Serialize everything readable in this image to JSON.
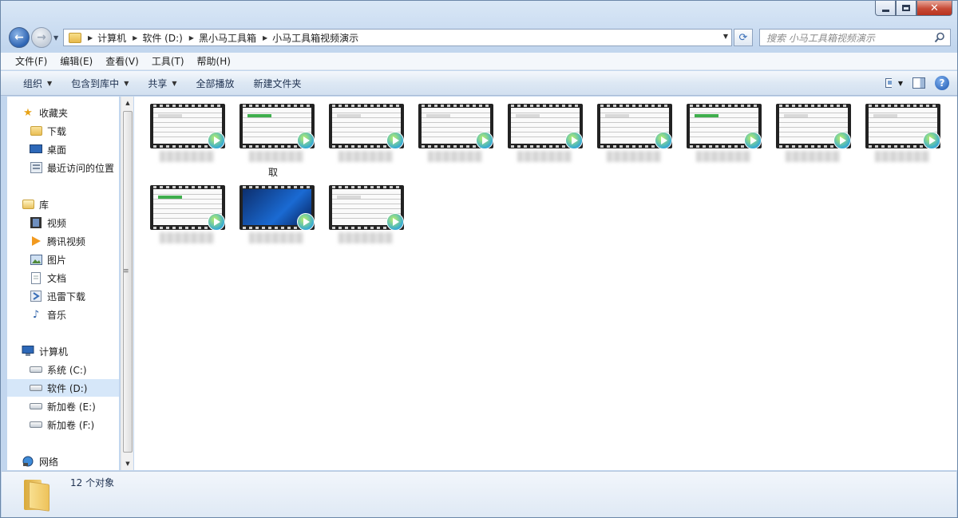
{
  "window": {
    "caption_buttons": [
      "minimize",
      "maximize",
      "close"
    ]
  },
  "address": {
    "breadcrumbs": [
      "计算机",
      "软件 (D:)",
      "黑小马工具箱",
      "小马工具箱视频演示"
    ]
  },
  "search": {
    "placeholder": "搜索 小马工具箱视频演示"
  },
  "menu": {
    "items": [
      "文件(F)",
      "编辑(E)",
      "查看(V)",
      "工具(T)",
      "帮助(H)"
    ]
  },
  "toolbar": {
    "organize": "组织",
    "include_in_library": "包含到库中",
    "share": "共享",
    "play_all": "全部播放",
    "new_folder": "新建文件夹"
  },
  "nav": {
    "favorites": "收藏夹",
    "fav_items": [
      "下载",
      "桌面",
      "最近访问的位置"
    ],
    "libraries": "库",
    "lib_items": [
      "视频",
      "腾讯视频",
      "图片",
      "文档",
      "迅雷下载",
      "音乐"
    ],
    "computer": "计算机",
    "drives": [
      "系统 (C:)",
      "软件 (D:)",
      "新加卷 (E:)",
      "新加卷 (F:)"
    ],
    "network": "网络"
  },
  "files": {
    "visible_label_fragment": "取",
    "thumbnail_icon": "video-file-icon"
  },
  "status": {
    "count": "12 个对象"
  },
  "colors": {
    "selected": "#d6e7f9",
    "play_badge": "#2fa6d8"
  }
}
